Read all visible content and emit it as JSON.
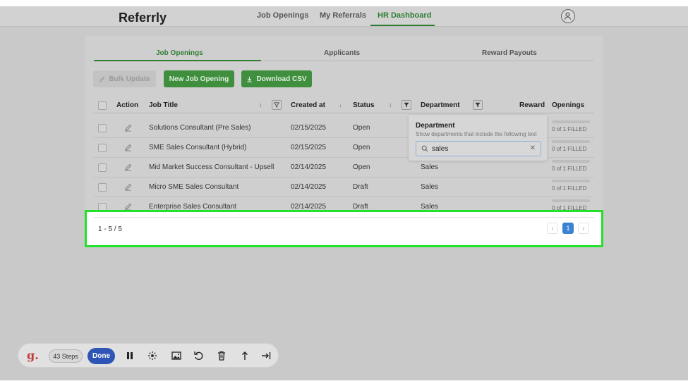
{
  "app": {
    "logo": "Referrly"
  },
  "nav": {
    "items": [
      "Job Openings",
      "My Referrals",
      "HR Dashboard"
    ],
    "active": "HR Dashboard"
  },
  "tabs": {
    "items": [
      "Job Openings",
      "Applicants",
      "Reward Payouts"
    ],
    "active": "Job Openings"
  },
  "toolbar_buttons": {
    "bulk": "Bulk Update",
    "new": "New Job Opening",
    "csv": "Download CSV"
  },
  "table": {
    "headers": {
      "action": "Action",
      "title": "Job Title",
      "created": "Created at",
      "status": "Status",
      "department": "Department",
      "reward": "Reward",
      "openings": "Openings"
    },
    "rows": [
      {
        "title": "Solutions Consultant (Pre Sales)",
        "created": "02/15/2025",
        "status": "Open",
        "department": "",
        "openings": "0 of 1 FILLED"
      },
      {
        "title": "SME Sales Consultant (Hybrid)",
        "created": "02/15/2025",
        "status": "Open",
        "department": "",
        "openings": "0 of 1 FILLED"
      },
      {
        "title": "Mid Market Success Consultant - Upsell",
        "created": "02/14/2025",
        "status": "Open",
        "department": "Sales",
        "openings": "0 of 1 FILLED"
      },
      {
        "title": "Micro SME Sales Consultant",
        "created": "02/14/2025",
        "status": "Draft",
        "department": "Sales",
        "openings": "0 of 1 FILLED"
      },
      {
        "title": "Enterprise Sales Consultant",
        "created": "02/14/2025",
        "status": "Draft",
        "department": "Sales",
        "openings": "0 of 1 FILLED"
      }
    ]
  },
  "filter_popup": {
    "title": "Department",
    "help": "Show departments that include the following text",
    "value": "sales"
  },
  "pagination": {
    "range": "1 - 5 / 5",
    "current_page": "1",
    "prev": "‹",
    "next": "›"
  },
  "recorder": {
    "logo": "g.",
    "steps": "43 Steps",
    "done": "Done"
  },
  "colors": {
    "brand_green": "#2e7d32",
    "highlight": "#22e22b",
    "page_blue": "#3d82d2",
    "done_blue": "#2e54b6"
  }
}
